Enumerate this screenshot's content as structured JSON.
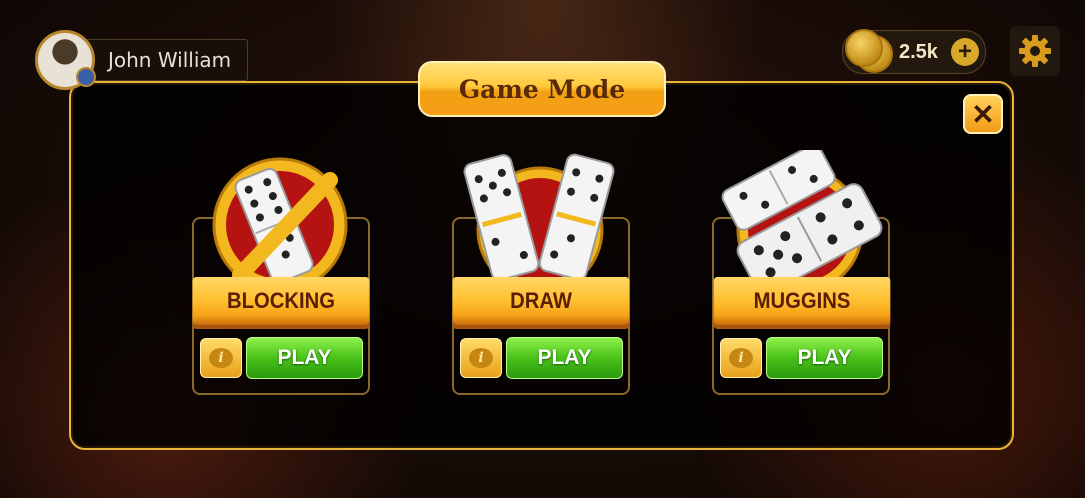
{
  "player": {
    "name": "John William"
  },
  "currency": {
    "coins": "2.5k",
    "plus_label": "+"
  },
  "dialog": {
    "title": "Game Mode",
    "close_label": "✕",
    "modes": [
      {
        "label": "BLOCKING",
        "info_label": "i",
        "play_label": "PLAY"
      },
      {
        "label": "DRAW",
        "info_label": "i",
        "play_label": "PLAY"
      },
      {
        "label": "MUGGINS",
        "info_label": "i",
        "play_label": "PLAY"
      }
    ]
  },
  "colors": {
    "accent_gold": "#ffc83a",
    "play_green": "#49c21a",
    "panel_border": "#e6b53a"
  },
  "icons": [
    "avatar",
    "coin-icon",
    "plus-icon",
    "gear-icon",
    "close-icon",
    "info-icon",
    "domino-icon"
  ]
}
